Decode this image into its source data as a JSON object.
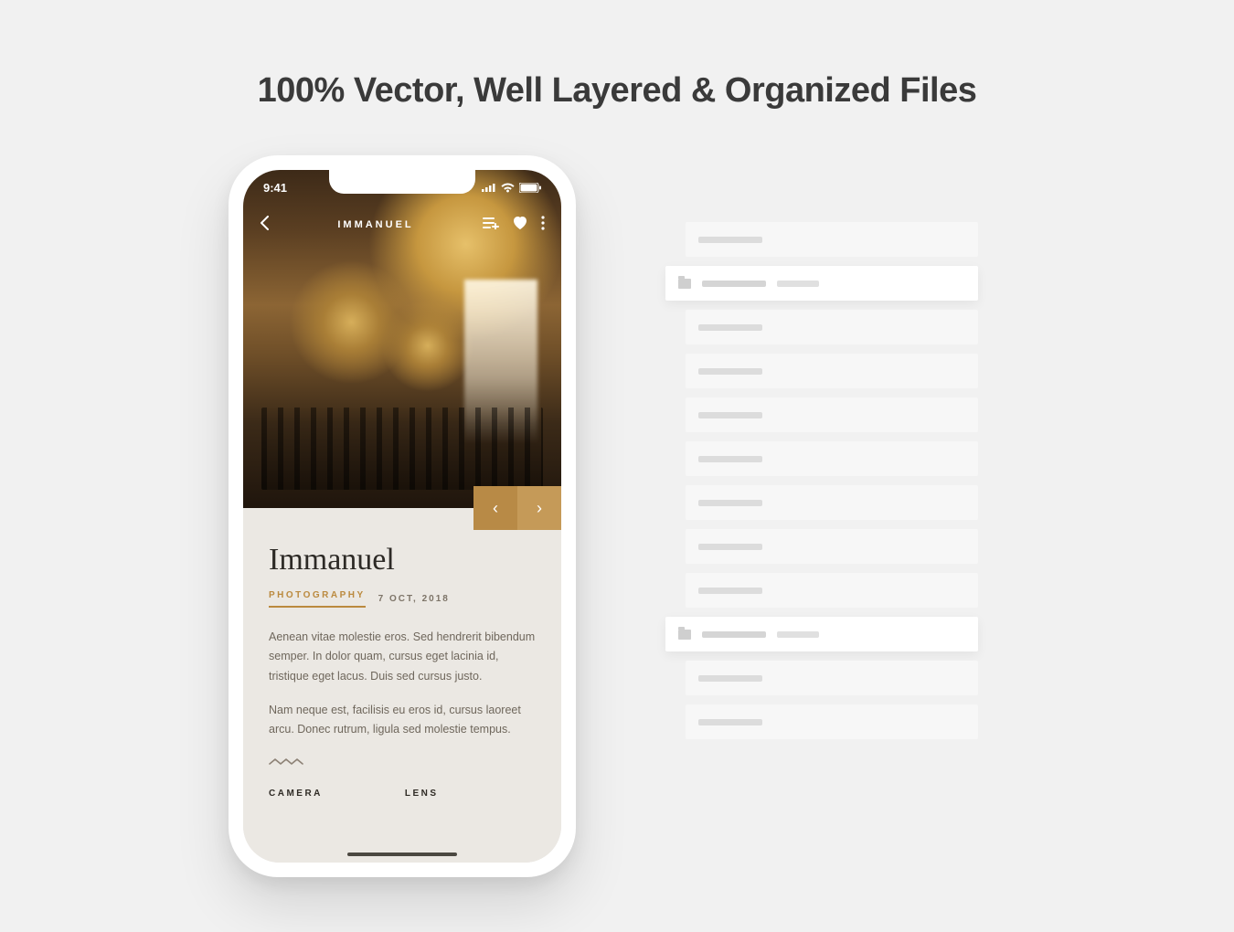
{
  "headline": "100% Vector, Well Layered & Organized Files",
  "status": {
    "time": "9:41"
  },
  "navbar": {
    "title": "IMMANUEL"
  },
  "pager": {
    "prev": "‹",
    "next": "›"
  },
  "article": {
    "title": "Immanuel",
    "category": "PHOTOGRAPHY",
    "date": "7 OCT, 2018",
    "p1": "Aenean vitae molestie eros. Sed hendrerit bibendum semper. In dolor quam, cursus eget lacinia id, tristique eget lacus. Duis sed cursus justo.",
    "p2": "Nam neque est, facilisis eu eros id, cursus laoreet arcu. Donec rutrum, ligula sed molestie tempus."
  },
  "specs": {
    "camera": "CAMERA",
    "lens": "LENS"
  }
}
